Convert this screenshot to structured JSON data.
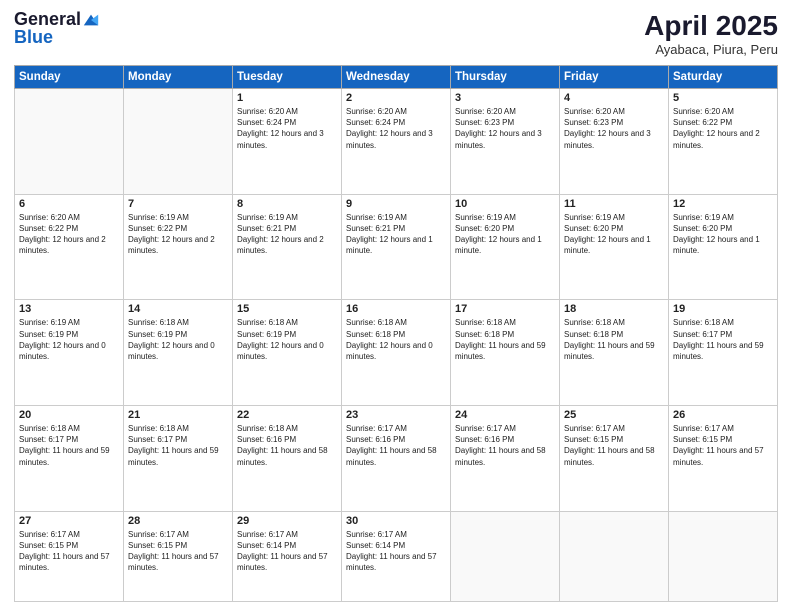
{
  "logo": {
    "general": "General",
    "blue": "Blue"
  },
  "header": {
    "month": "April 2025",
    "location": "Ayabaca, Piura, Peru"
  },
  "weekdays": [
    "Sunday",
    "Monday",
    "Tuesday",
    "Wednesday",
    "Thursday",
    "Friday",
    "Saturday"
  ],
  "weeks": [
    [
      {
        "day": "",
        "info": ""
      },
      {
        "day": "",
        "info": ""
      },
      {
        "day": "1",
        "info": "Sunrise: 6:20 AM\nSunset: 6:24 PM\nDaylight: 12 hours and 3 minutes."
      },
      {
        "day": "2",
        "info": "Sunrise: 6:20 AM\nSunset: 6:24 PM\nDaylight: 12 hours and 3 minutes."
      },
      {
        "day": "3",
        "info": "Sunrise: 6:20 AM\nSunset: 6:23 PM\nDaylight: 12 hours and 3 minutes."
      },
      {
        "day": "4",
        "info": "Sunrise: 6:20 AM\nSunset: 6:23 PM\nDaylight: 12 hours and 3 minutes."
      },
      {
        "day": "5",
        "info": "Sunrise: 6:20 AM\nSunset: 6:22 PM\nDaylight: 12 hours and 2 minutes."
      }
    ],
    [
      {
        "day": "6",
        "info": "Sunrise: 6:20 AM\nSunset: 6:22 PM\nDaylight: 12 hours and 2 minutes."
      },
      {
        "day": "7",
        "info": "Sunrise: 6:19 AM\nSunset: 6:22 PM\nDaylight: 12 hours and 2 minutes."
      },
      {
        "day": "8",
        "info": "Sunrise: 6:19 AM\nSunset: 6:21 PM\nDaylight: 12 hours and 2 minutes."
      },
      {
        "day": "9",
        "info": "Sunrise: 6:19 AM\nSunset: 6:21 PM\nDaylight: 12 hours and 1 minute."
      },
      {
        "day": "10",
        "info": "Sunrise: 6:19 AM\nSunset: 6:20 PM\nDaylight: 12 hours and 1 minute."
      },
      {
        "day": "11",
        "info": "Sunrise: 6:19 AM\nSunset: 6:20 PM\nDaylight: 12 hours and 1 minute."
      },
      {
        "day": "12",
        "info": "Sunrise: 6:19 AM\nSunset: 6:20 PM\nDaylight: 12 hours and 1 minute."
      }
    ],
    [
      {
        "day": "13",
        "info": "Sunrise: 6:19 AM\nSunset: 6:19 PM\nDaylight: 12 hours and 0 minutes."
      },
      {
        "day": "14",
        "info": "Sunrise: 6:18 AM\nSunset: 6:19 PM\nDaylight: 12 hours and 0 minutes."
      },
      {
        "day": "15",
        "info": "Sunrise: 6:18 AM\nSunset: 6:19 PM\nDaylight: 12 hours and 0 minutes."
      },
      {
        "day": "16",
        "info": "Sunrise: 6:18 AM\nSunset: 6:18 PM\nDaylight: 12 hours and 0 minutes."
      },
      {
        "day": "17",
        "info": "Sunrise: 6:18 AM\nSunset: 6:18 PM\nDaylight: 11 hours and 59 minutes."
      },
      {
        "day": "18",
        "info": "Sunrise: 6:18 AM\nSunset: 6:18 PM\nDaylight: 11 hours and 59 minutes."
      },
      {
        "day": "19",
        "info": "Sunrise: 6:18 AM\nSunset: 6:17 PM\nDaylight: 11 hours and 59 minutes."
      }
    ],
    [
      {
        "day": "20",
        "info": "Sunrise: 6:18 AM\nSunset: 6:17 PM\nDaylight: 11 hours and 59 minutes."
      },
      {
        "day": "21",
        "info": "Sunrise: 6:18 AM\nSunset: 6:17 PM\nDaylight: 11 hours and 59 minutes."
      },
      {
        "day": "22",
        "info": "Sunrise: 6:18 AM\nSunset: 6:16 PM\nDaylight: 11 hours and 58 minutes."
      },
      {
        "day": "23",
        "info": "Sunrise: 6:17 AM\nSunset: 6:16 PM\nDaylight: 11 hours and 58 minutes."
      },
      {
        "day": "24",
        "info": "Sunrise: 6:17 AM\nSunset: 6:16 PM\nDaylight: 11 hours and 58 minutes."
      },
      {
        "day": "25",
        "info": "Sunrise: 6:17 AM\nSunset: 6:15 PM\nDaylight: 11 hours and 58 minutes."
      },
      {
        "day": "26",
        "info": "Sunrise: 6:17 AM\nSunset: 6:15 PM\nDaylight: 11 hours and 57 minutes."
      }
    ],
    [
      {
        "day": "27",
        "info": "Sunrise: 6:17 AM\nSunset: 6:15 PM\nDaylight: 11 hours and 57 minutes."
      },
      {
        "day": "28",
        "info": "Sunrise: 6:17 AM\nSunset: 6:15 PM\nDaylight: 11 hours and 57 minutes."
      },
      {
        "day": "29",
        "info": "Sunrise: 6:17 AM\nSunset: 6:14 PM\nDaylight: 11 hours and 57 minutes."
      },
      {
        "day": "30",
        "info": "Sunrise: 6:17 AM\nSunset: 6:14 PM\nDaylight: 11 hours and 57 minutes."
      },
      {
        "day": "",
        "info": ""
      },
      {
        "day": "",
        "info": ""
      },
      {
        "day": "",
        "info": ""
      }
    ]
  ]
}
